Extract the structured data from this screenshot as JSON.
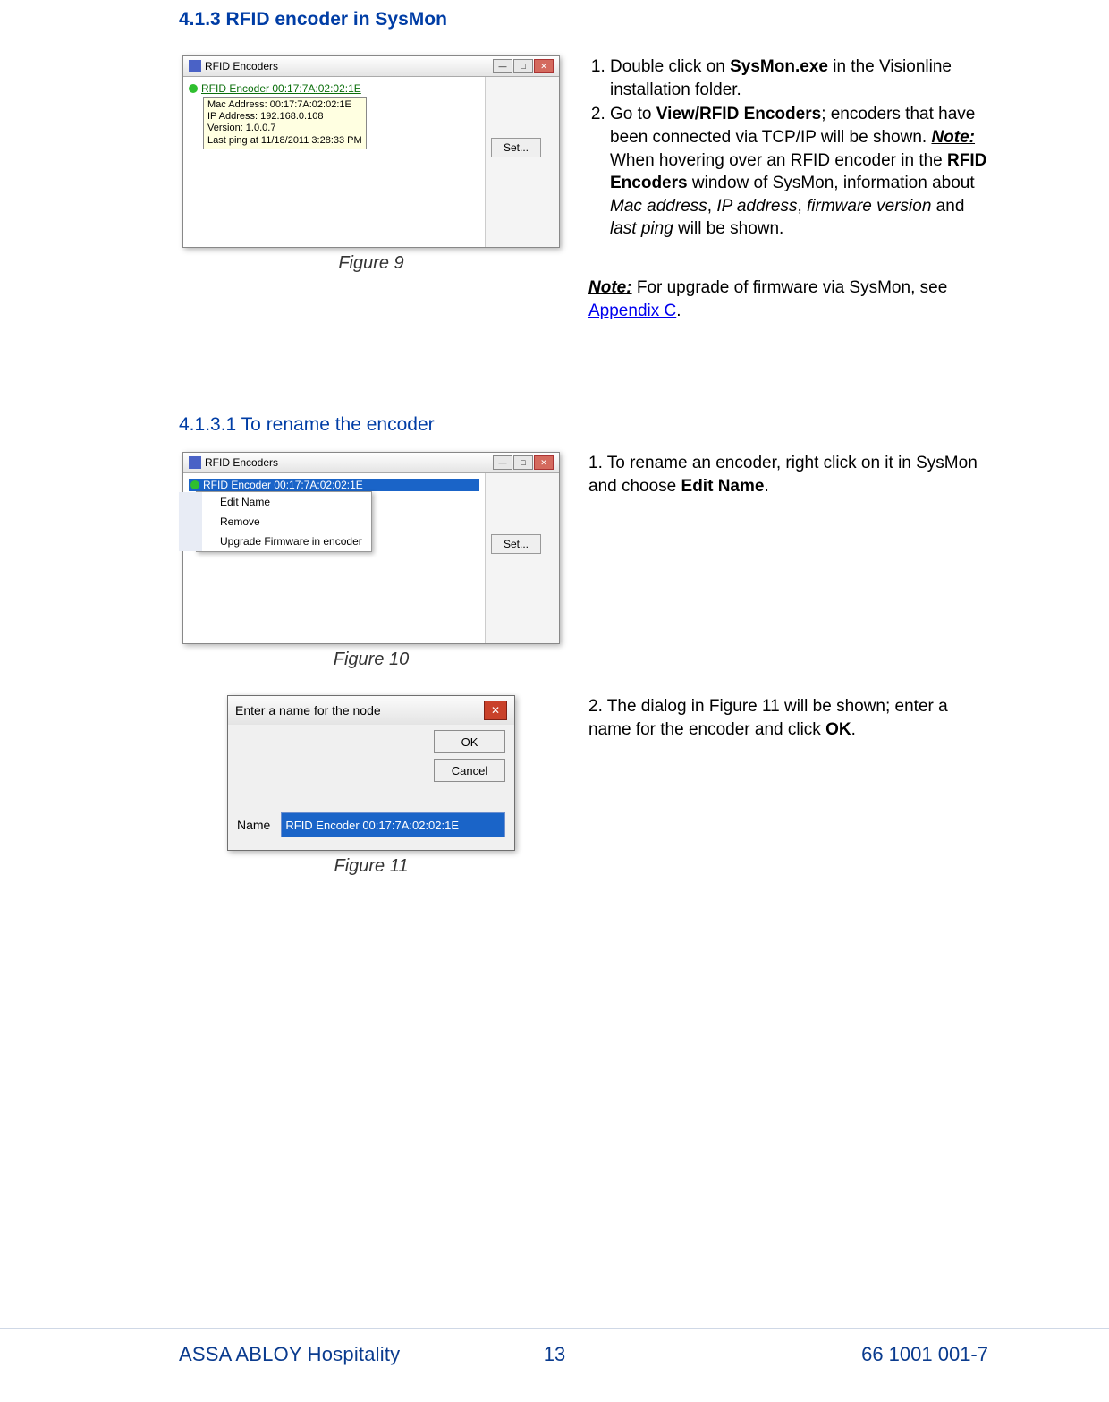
{
  "headings": {
    "h1": "4.1.3 RFID encoder in SysMon",
    "h2": "4.1.3.1 To rename the encoder"
  },
  "captions": {
    "fig9": "Figure 9",
    "fig10": "Figure 10",
    "fig11": "Figure 11"
  },
  "instructions_a": {
    "li1_pre": "Double click on ",
    "li1_bold": "SysMon.exe",
    "li1_post": " in the Visionline installation folder.",
    "li2_pre": "Go to ",
    "li2_bold": "View/RFID Encoders",
    "li2_mid1": "; encoders that have been connected via TCP/IP will be shown. ",
    "li2_note_label": "Note:",
    "li2_mid2": " When hovering over an RFID encoder in the ",
    "li2_bold2": "RFID Encoders",
    "li2_mid3": " window of SysMon, information about ",
    "li2_i1": "Mac address",
    "li2_sep1": ", ",
    "li2_i2": "IP address",
    "li2_sep2": ", ",
    "li2_i3": "firmware version",
    "li2_sep3": " and ",
    "li2_i4": "last ping",
    "li2_post": " will be shown."
  },
  "note_block": {
    "label": "Note:",
    "t1": " For upgrade of firmware via SysMon, see ",
    "link": "Appendix C",
    "t2": "."
  },
  "instructions_b": {
    "li1_pre": "To rename an encoder, right click on it in SysMon and choose ",
    "li1_bold": "Edit Name",
    "li1_post": "."
  },
  "instructions_c": {
    "li2_pre": "The dialog in Figure 11 will be shown; enter a name for the encoder and click ",
    "li2_bold": "OK",
    "li2_post": "."
  },
  "win1": {
    "title": "RFID Encoders",
    "encoder": "RFID Encoder 00:17:7A:02:02:1E",
    "tooltip_l1": "Mac Address: 00:17:7A:02:02:1E",
    "tooltip_l2": "IP Address: 192.168.0.108",
    "tooltip_l3": "Version: 1.0.0.7",
    "tooltip_l4": "Last ping at 11/18/2011 3:28:33 PM",
    "set_btn": "Set..."
  },
  "win2": {
    "title": "RFID Encoders",
    "encoder": "RFID Encoder 00:17:7A:02:02:1E",
    "menu1": "Edit Name",
    "menu2": "Remove",
    "menu3": "Upgrade Firmware in encoder",
    "set_btn": "Set..."
  },
  "dlg": {
    "title": "Enter a name for the node",
    "ok": "OK",
    "cancel": "Cancel",
    "name_lbl": "Name",
    "name_val": "RFID Encoder 00:17:7A:02:02:1E"
  },
  "footer": {
    "brand": "ASSA ABLOY Hospitality",
    "page": "13",
    "docnum": "66 1001 001-7"
  }
}
